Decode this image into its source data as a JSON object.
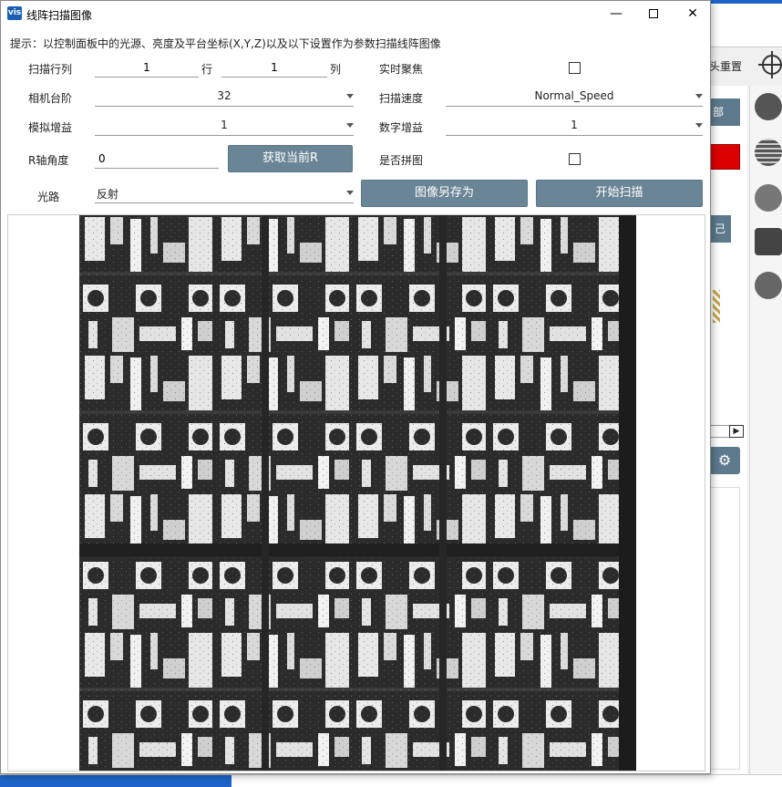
{
  "window": {
    "title": "线阵扫描图像",
    "icon_text": "vis",
    "minimize": "—",
    "close": "✕"
  },
  "hint": "提示：以控制面板中的光源、亮度及平台坐标(X,Y,Z)以及以下设置作为参数扫描线阵图像",
  "form": {
    "scan_rowcol_label": "扫描行列",
    "rows_value": "1",
    "rows_unit": "行",
    "cols_value": "1",
    "cols_unit": "列",
    "realtime_focus_label": "实时聚焦",
    "realtime_focus_checked": false,
    "camera_step_label": "相机台阶",
    "camera_step_value": "32",
    "scan_speed_label": "扫描速度",
    "scan_speed_value": "Normal_Speed",
    "analog_gain_label": "模拟增益",
    "analog_gain_value": "1",
    "digital_gain_label": "数字增益",
    "digital_gain_value": "1",
    "r_angle_label": "R轴角度",
    "r_angle_value": "0",
    "get_r_button": "获取当前R",
    "stitch_label": "是否拼图",
    "stitch_checked": false,
    "optical_path_label": "光路",
    "optical_path_value": "反射",
    "save_image_button": "图像另存为",
    "start_scan_button": "开始扫描"
  },
  "background_app": {
    "reset_label": "头重置",
    "btn1_label": "部",
    "btn2_label": "己"
  },
  "colors": {
    "button_bg": "#6a8595",
    "accent_blue": "#1e64c8",
    "alert_red": "#dd0000"
  },
  "icons": [
    "app-icon",
    "minimize-icon",
    "maximize-icon",
    "close-icon",
    "dropdown-caret-icon",
    "crosshair-icon",
    "camera-icon",
    "grid-icon",
    "gear-refresh-icon",
    "image-icon"
  ]
}
